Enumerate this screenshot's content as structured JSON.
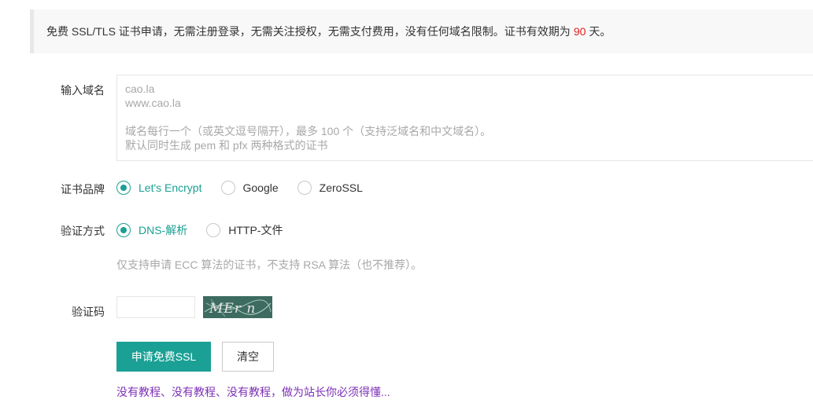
{
  "notice": {
    "text_before": "免费 SSL/TLS 证书申请，无需注册登录，无需关注授权，无需支付费用，没有任何域名限制。证书有效期为",
    "days": "90",
    "text_after": "天。",
    "days_color": "#e02020"
  },
  "domain": {
    "label": "输入域名",
    "placeholder_lines": [
      "cao.la",
      "www.cao.la",
      "",
      "域名每行一个（或英文逗号隔开），最多 100 个（支持泛域名和中文域名）。",
      "默认同时生成 pem 和 pfx 两种格式的证书"
    ]
  },
  "brand": {
    "label": "证书品牌",
    "options": [
      {
        "label": "Let's Encrypt",
        "selected": true
      },
      {
        "label": "Google",
        "selected": false
      },
      {
        "label": "ZeroSSL",
        "selected": false
      }
    ]
  },
  "verify": {
    "label": "验证方式",
    "options": [
      {
        "label": "DNS-解析",
        "selected": true
      },
      {
        "label": "HTTP-文件",
        "selected": false
      }
    ],
    "hint": "仅支持申请 ECC 算法的证书，不支持 RSA 算法（也不推荐）。"
  },
  "captcha": {
    "label": "验证码",
    "value": "",
    "image_text": "MEr n"
  },
  "actions": {
    "submit_label": "申请免费SSL",
    "clear_label": "清空"
  },
  "footer": {
    "link_text": "没有教程、没有教程、没有教程，做为站长你必须得懂..."
  },
  "colors": {
    "accent": "#1aa094",
    "link": "#7c2fb5",
    "placeholder": "#a8a8a8"
  }
}
